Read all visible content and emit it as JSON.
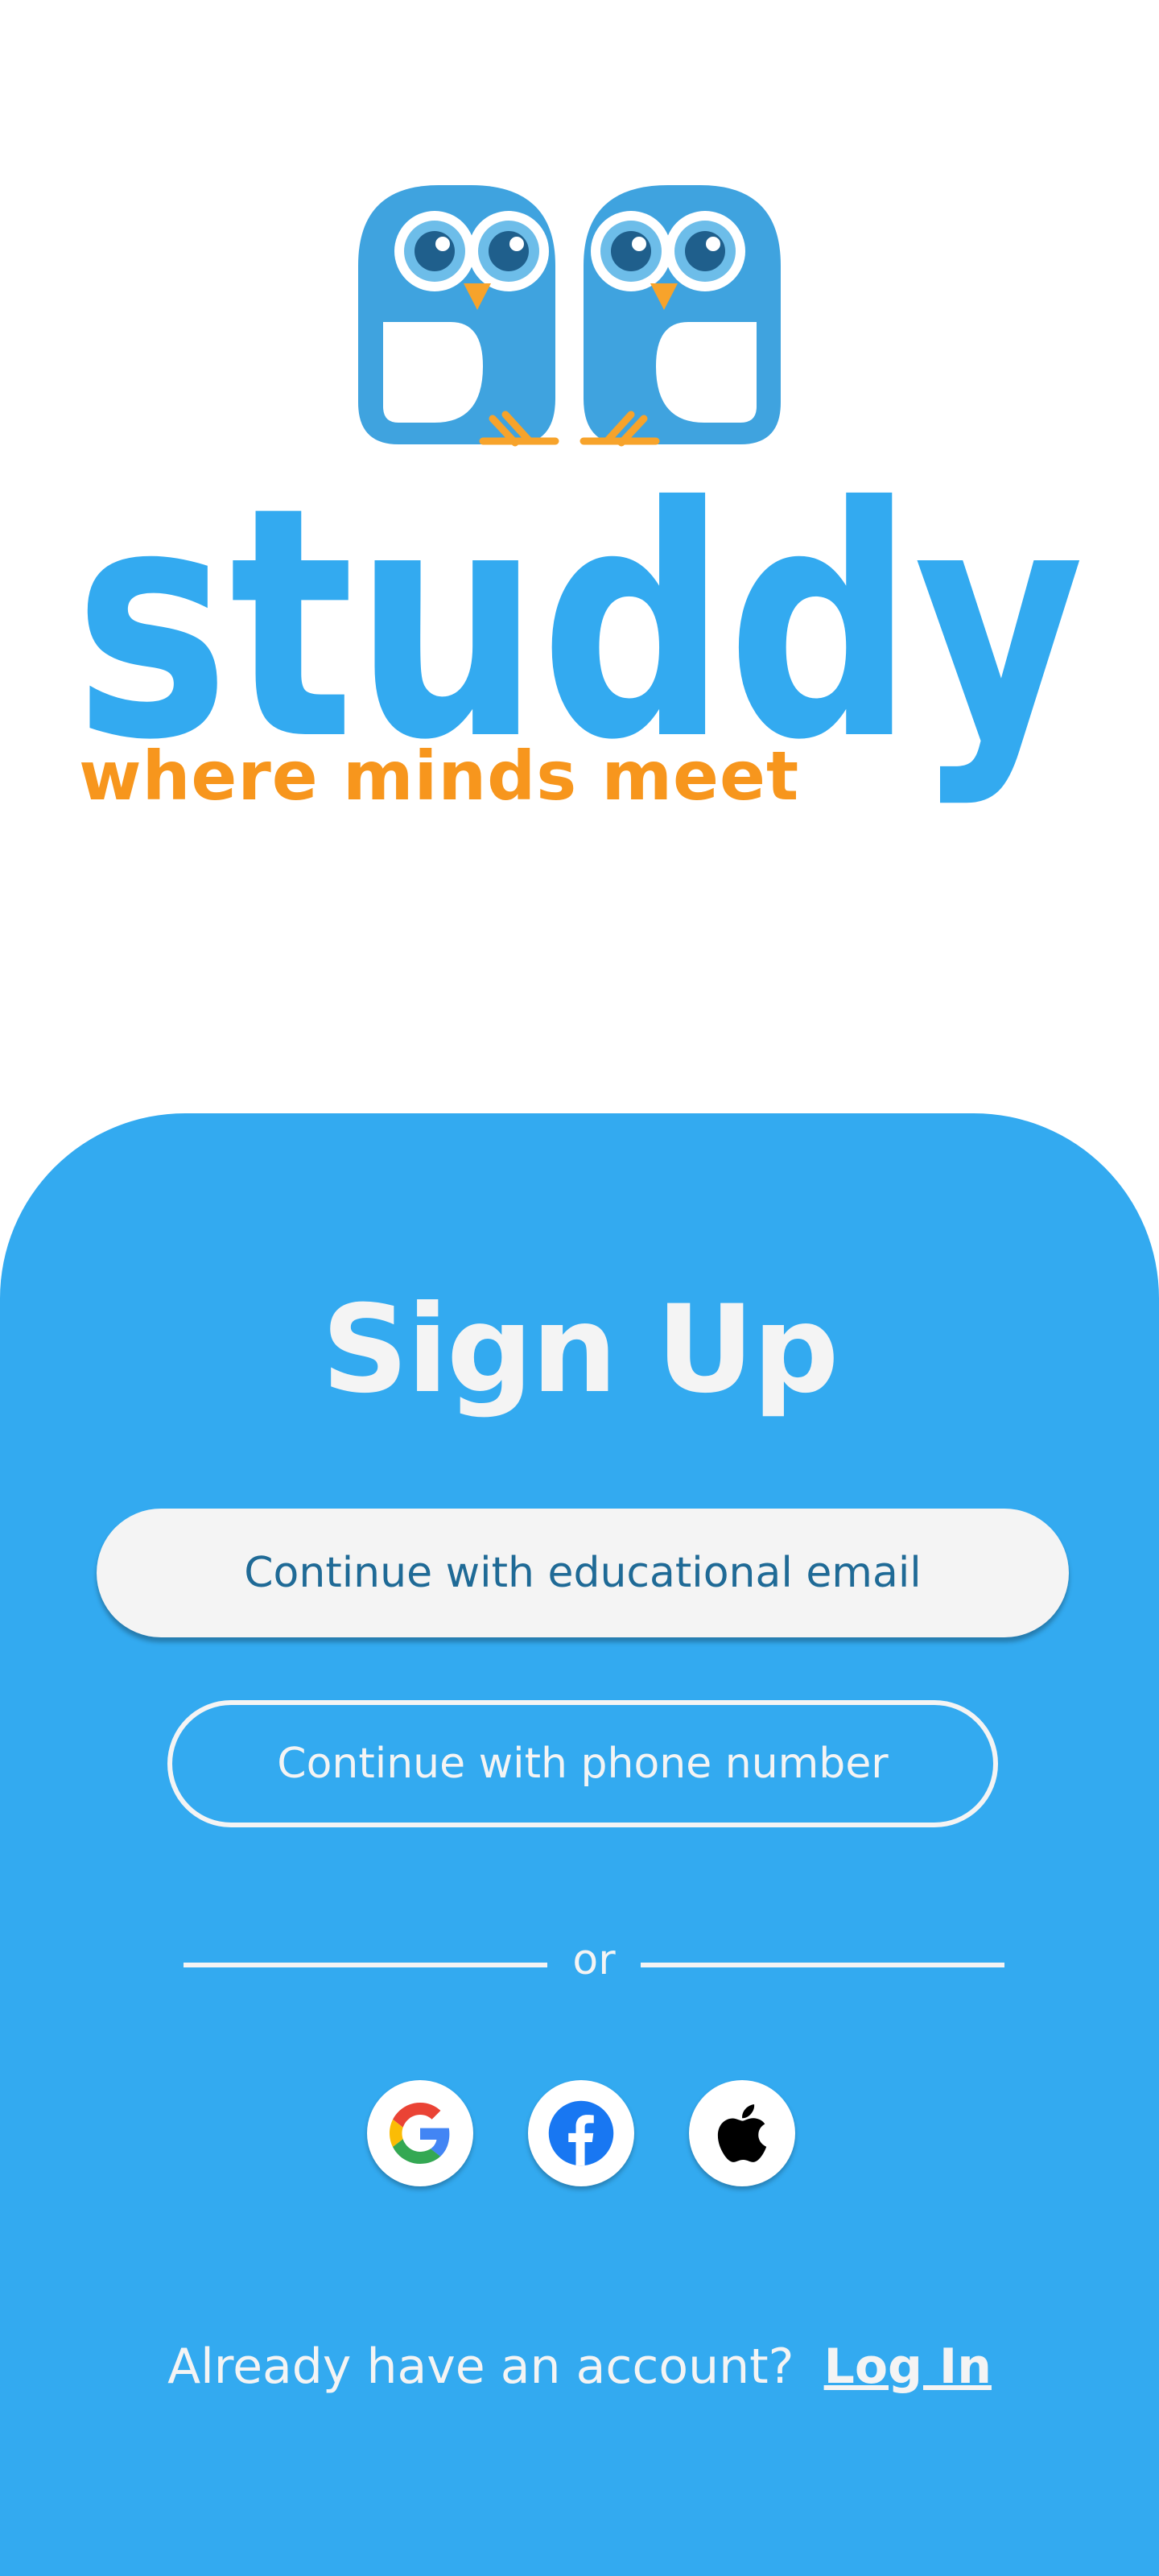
{
  "brand": {
    "name": "studdy",
    "tagline": "where minds meet",
    "logo": "two-owls-logo",
    "colors": {
      "primary_blue": "#33aaf0",
      "owl_blue": "#3fa3df",
      "tagline_orange": "#f7961d",
      "panel_text": "#f4f4f4"
    }
  },
  "signup": {
    "title": "Sign Up",
    "email_button": "Continue with educational email",
    "phone_button": "Continue with phone number",
    "divider_text": "or",
    "social": [
      {
        "icon": "google-icon",
        "label": "Google"
      },
      {
        "icon": "facebook-icon",
        "label": "Facebook"
      },
      {
        "icon": "apple-icon",
        "label": "Apple"
      }
    ]
  },
  "footer": {
    "prompt": "Already have an account?",
    "login_link": "Log In"
  }
}
